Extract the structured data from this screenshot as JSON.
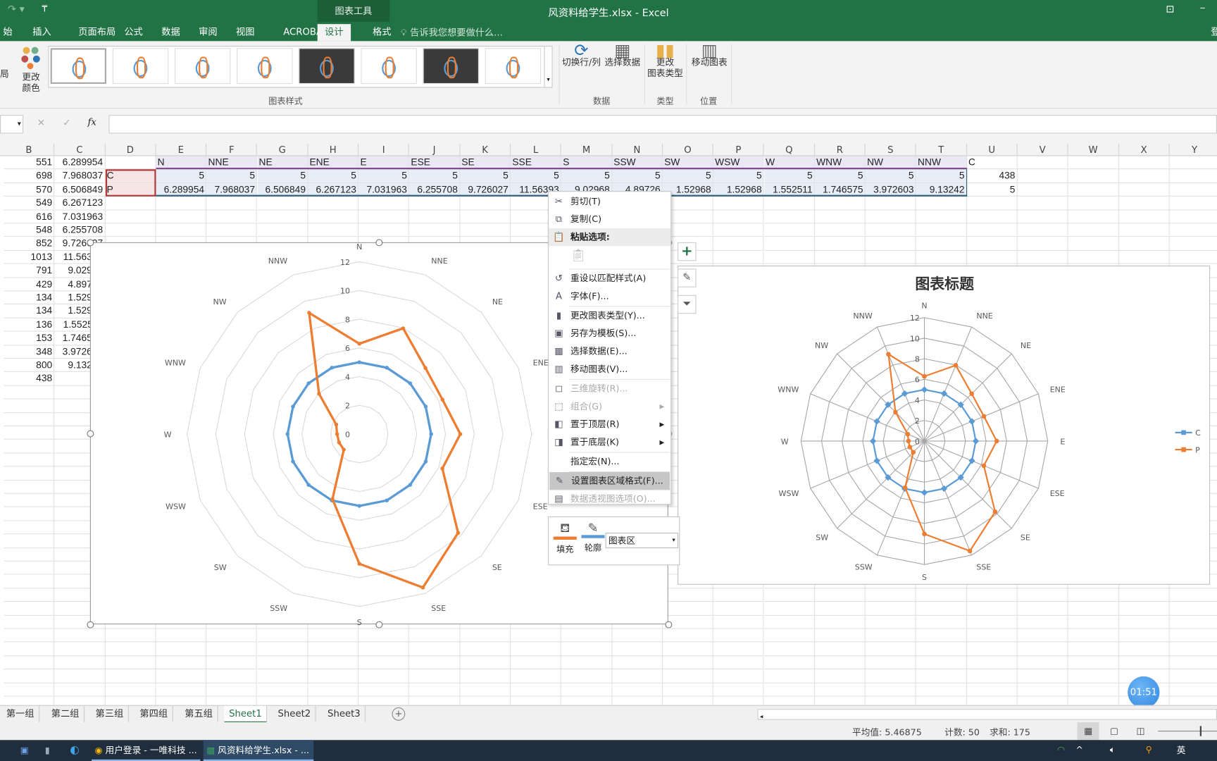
{
  "window": {
    "title": "风资料给学生.xlsx - Excel",
    "context_tab_group": "图表工具",
    "signin": "登"
  },
  "ribbon_tabs": [
    {
      "label": "始"
    },
    {
      "label": "插入"
    },
    {
      "label": "页面布局"
    },
    {
      "label": "公式"
    },
    {
      "label": "数据"
    },
    {
      "label": "审阅"
    },
    {
      "label": "视图"
    },
    {
      "label": "ACROBAT"
    },
    {
      "label": "设计",
      "active": true
    },
    {
      "label": "格式"
    }
  ],
  "tell_me": "告诉我您想要做什么...",
  "ribbon": {
    "layout_partial": "局",
    "change_colors": "更改\n颜色",
    "chart_styles_group": "图表样式",
    "switch_row_col": "切换行/列",
    "select_data": "选择数据",
    "data_group": "数据",
    "change_chart_type": "更改\n图表类型",
    "type_group": "类型",
    "move_chart": "移动图表",
    "location_group": "位置"
  },
  "formula_bar": {
    "fx": "fx",
    "value": ""
  },
  "columns": [
    "B",
    "C",
    "D",
    "E",
    "F",
    "G",
    "H",
    "I",
    "J",
    "K",
    "L",
    "M",
    "N",
    "O",
    "P",
    "Q",
    "R",
    "S",
    "T",
    "U",
    "V",
    "W",
    "X",
    "Y"
  ],
  "sheet": {
    "colB": [
      "551",
      "698",
      "570",
      "549",
      "616",
      "548",
      "852",
      "1013",
      "791",
      "429",
      "134",
      "134",
      "136",
      "153",
      "348",
      "800",
      "438"
    ],
    "colC": [
      "6.289954",
      "7.968037",
      "6.506849",
      "6.267123",
      "7.031963",
      "6.255708",
      "9.726027",
      "11.56393",
      "9.02968",
      "4.89726",
      "1.52968",
      "1.52968",
      "1.552511",
      "1.746575",
      "3.972603",
      "9.13242"
    ],
    "D": [
      "",
      "C",
      "P"
    ],
    "headers": [
      "N",
      "NNE",
      "NE",
      "ENE",
      "E",
      "ESE",
      "SE",
      "SSE",
      "S",
      "SSW",
      "SW",
      "WSW",
      "W",
      "WNW",
      "NW",
      "NNW"
    ],
    "rowC": [
      "5",
      "5",
      "5",
      "5",
      "5",
      "5",
      "5",
      "5",
      "5",
      "5",
      "5",
      "5",
      "5",
      "5",
      "5",
      "5"
    ],
    "rowP": [
      "6.289954",
      "7.968037",
      "6.506849",
      "6.267123",
      "7.031963",
      "6.255708",
      "9.726027",
      "11.56393",
      "9.02968",
      "4.89726",
      "1.52968",
      "1.52968",
      "1.552511",
      "1.746575",
      "3.972603",
      "9.13242"
    ],
    "U": [
      "C",
      "438",
      "5"
    ]
  },
  "chart_data": [
    {
      "type": "radar",
      "title": "",
      "categories": [
        "N",
        "NNE",
        "NE",
        "ENE",
        "E",
        "ESE",
        "SE",
        "SSE",
        "S",
        "SSW",
        "SW",
        "WSW",
        "W",
        "WNW",
        "NW",
        "NNW"
      ],
      "axis": {
        "min": 0,
        "max": 12,
        "step": 2,
        "ticks": [
          "0",
          "2",
          "4",
          "6",
          "8",
          "10",
          "12"
        ]
      },
      "series": [
        {
          "values": [
            5,
            5,
            5,
            5,
            5,
            5,
            5,
            5,
            5,
            5,
            5,
            5,
            5,
            5,
            5,
            5
          ],
          "color": "#5b9bd5"
        },
        {
          "values": [
            6.289954,
            7.968037,
            6.506849,
            6.267123,
            7.031963,
            6.255708,
            9.726027,
            11.56393,
            9.02968,
            4.89726,
            1.52968,
            1.52968,
            1.552511,
            1.746575,
            3.972603,
            9.13242
          ],
          "color": "#ed7d31"
        }
      ],
      "legend": "none",
      "grid": true
    },
    {
      "type": "radar",
      "title": "图表标题",
      "categories": [
        "N",
        "NNE",
        "NE",
        "ENE",
        "E",
        "ESE",
        "SE",
        "SSE",
        "S",
        "SSW",
        "SW",
        "WSW",
        "W",
        "WNW",
        "NW",
        "NNW"
      ],
      "axis": {
        "min": 0,
        "max": 12,
        "step": 2,
        "ticks": [
          "0",
          "2",
          "4",
          "6",
          "8",
          "10",
          "12"
        ]
      },
      "series": [
        {
          "name": "C",
          "values": [
            5,
            5,
            5,
            5,
            5,
            5,
            5,
            5,
            5,
            5,
            5,
            5,
            5,
            5,
            5,
            5
          ],
          "color": "#5b9bd5"
        },
        {
          "name": "P",
          "values": [
            6.289954,
            7.968037,
            6.506849,
            6.267123,
            7.031963,
            6.255708,
            9.726027,
            11.56393,
            9.02968,
            4.89726,
            1.52968,
            1.52968,
            1.552511,
            1.746575,
            3.972603,
            9.13242
          ],
          "color": "#ed7d31"
        }
      ],
      "legend": "right",
      "grid": true
    }
  ],
  "context_menu": [
    {
      "label": "剪切(T)",
      "icon": "scissors-icon",
      "g": "✂"
    },
    {
      "label": "复制(C)",
      "icon": "copy-icon",
      "g": "⧉"
    },
    {
      "label": "粘贴选项:",
      "icon": "paste-icon",
      "g": "📋",
      "header": true
    },
    {
      "label": "重设以匹配样式(A)",
      "icon": "reset-style-icon",
      "g": "↺"
    },
    {
      "label": "字体(F)...",
      "icon": "font-icon",
      "g": "A"
    },
    {
      "label": "更改图表类型(Y)...",
      "icon": "chart-type-icon",
      "g": "▮"
    },
    {
      "label": "另存为模板(S)...",
      "icon": "save-template-icon",
      "g": "▣"
    },
    {
      "label": "选择数据(E)...",
      "icon": "select-data-icon",
      "g": "▦"
    },
    {
      "label": "移动图表(V)...",
      "icon": "move-chart-icon",
      "g": "▥"
    },
    {
      "label": "三维旋转(R)...",
      "icon": "3d-rotate-icon",
      "g": "◻",
      "disabled": true
    },
    {
      "label": "组合(G)",
      "icon": "group-icon",
      "g": "⬚",
      "disabled": true,
      "submenu": true
    },
    {
      "label": "置于顶层(R)",
      "icon": "bring-front-icon",
      "g": "◧",
      "submenu": true
    },
    {
      "label": "置于底层(K)",
      "icon": "send-back-icon",
      "g": "◨",
      "submenu": true
    },
    {
      "label": "指定宏(N)...",
      "icon": "",
      "g": ""
    },
    {
      "label": "设置图表区域格式(F)...",
      "icon": "format-chart-area-icon",
      "g": "✎",
      "highlight": true
    },
    {
      "label": "数据透视图选项(O)...",
      "icon": "pivot-options-icon",
      "g": "▤",
      "disabled": true
    }
  ],
  "mini_toolbar": {
    "fill": "填充",
    "outline": "轮廓",
    "element": "图表区"
  },
  "sheet_tabs": [
    {
      "label": "第一组"
    },
    {
      "label": "第二组"
    },
    {
      "label": "第三组"
    },
    {
      "label": "第四组"
    },
    {
      "label": "第五组"
    },
    {
      "label": "Sheet1",
      "active": true
    },
    {
      "label": "Sheet2"
    },
    {
      "label": "Sheet3"
    }
  ],
  "status": {
    "average": "平均值: 5.46875",
    "count": "计数: 50",
    "sum": "求和: 175"
  },
  "timer": "01:51",
  "taskbar": {
    "app1": "用户登录 - 一唯科技 ...",
    "app2": "风资料给学生.xlsx - ...",
    "ime": "英"
  }
}
